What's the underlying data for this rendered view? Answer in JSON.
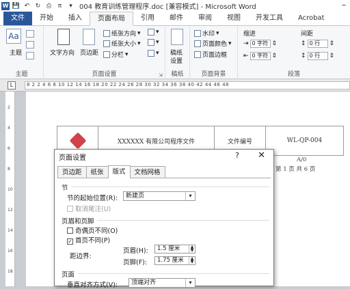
{
  "titlebar": {
    "title": "004 教育训练管理程序.doc [兼容模式] - Microsoft Word",
    "qa_icons": [
      "word-logo",
      "save-icon",
      "undo-icon",
      "redo-icon",
      "print-icon"
    ],
    "separator": "π",
    "minimize": "–"
  },
  "tabs": [
    "文件",
    "开始",
    "插入",
    "页面布局",
    "引用",
    "邮件",
    "审阅",
    "视图",
    "开发工具",
    "Acrobat"
  ],
  "ribbon": {
    "theme": {
      "label": "主题",
      "group": "主题"
    },
    "page_setup": {
      "text_dir": "文字方向",
      "margins": "页边距",
      "orientation": "纸张方向",
      "size": "纸张大小",
      "columns": "分栏",
      "group": "页面设置"
    },
    "manuscript": {
      "label1": "稿纸",
      "label2": "设置",
      "group": "稿纸"
    },
    "background": {
      "watermark": "水印",
      "page_color": "页面颜色",
      "page_border": "页面边框",
      "group": "页面背景"
    },
    "paragraph": {
      "indent": "缩进",
      "spacing": "间距",
      "indent_left": "0 字符",
      "indent_right": "0 字符",
      "space_before": "0 行",
      "space_after": "0 行",
      "group": "段落"
    }
  },
  "ruler": {
    "ticks": "8  2     2   4   6   8   10  12  14  16  18  20  22  24  26  28  30  32  34  36  38  40  42  44  46  48",
    "vticks": [
      "2",
      "4",
      "6",
      "8",
      "10",
      "12",
      "14",
      "16",
      "18"
    ],
    "corner": "L"
  },
  "document": {
    "company": "XXXXXX 有限公司程序文件",
    "doc_no_label": "文件编号",
    "doc_no": "WL-QP-004",
    "version": "A/0",
    "page": "第 1 页 共 6 页"
  },
  "dialog": {
    "title": "页面设置",
    "help": "?",
    "close": "✕",
    "tabs": [
      "页边距",
      "纸张",
      "版式",
      "文档网格"
    ],
    "active_tab": "版式",
    "section_heading": "节",
    "section_start_label": "节的起始位置(R):",
    "section_start_value": "新建页",
    "suppress_endnotes": "取消尾注(U)",
    "header_footer_heading": "页眉和页脚",
    "odd_even": "奇偶页不同(O)",
    "first_page": "首页不同(P)",
    "from_edge": "距边界:",
    "header_label": "页眉(H):",
    "header_value": "1.5 厘米",
    "footer_label": "页脚(F):",
    "footer_value": "1.75 厘米",
    "page_heading": "页面",
    "vertical_align_label": "垂直对齐方式(V):",
    "vertical_align_value": "顶端对齐"
  }
}
